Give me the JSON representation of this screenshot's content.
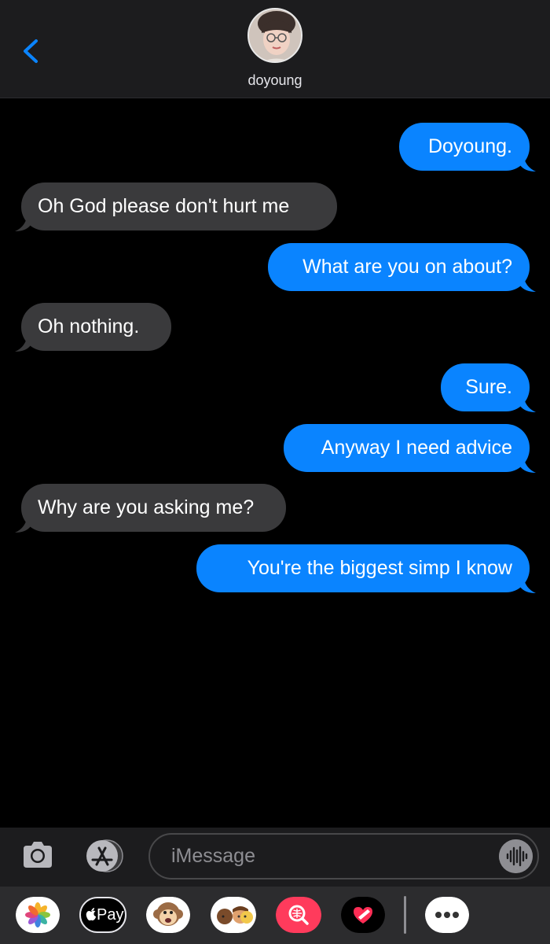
{
  "header": {
    "contact_name": "doyoung"
  },
  "messages": [
    {
      "direction": "sent",
      "text": "Doyoung."
    },
    {
      "direction": "received",
      "text": "Oh God please don't hurt me"
    },
    {
      "direction": "sent",
      "text": "What are you on about?"
    },
    {
      "direction": "received",
      "text": "Oh nothing."
    },
    {
      "direction": "sent",
      "text": "Sure."
    },
    {
      "direction": "sent",
      "text": "Anyway I need advice"
    },
    {
      "direction": "received",
      "text": "Why are you asking me?"
    },
    {
      "direction": "sent",
      "text": "You're the biggest simp I know"
    }
  ],
  "composer": {
    "placeholder": "iMessage"
  },
  "app_strip": {
    "items": [
      {
        "icon": "photos-icon"
      },
      {
        "icon": "apple-pay-icon",
        "label": "Pay"
      },
      {
        "icon": "animoji-monkey-icon"
      },
      {
        "icon": "memoji-icon"
      },
      {
        "icon": "images-search-icon"
      },
      {
        "icon": "digital-touch-icon"
      },
      {
        "icon": "more-icon"
      }
    ]
  },
  "colors": {
    "sent_bubble": "#0a84ff",
    "received_bubble": "#3a3a3c",
    "accent": "#0a84ff",
    "background": "#000000"
  }
}
